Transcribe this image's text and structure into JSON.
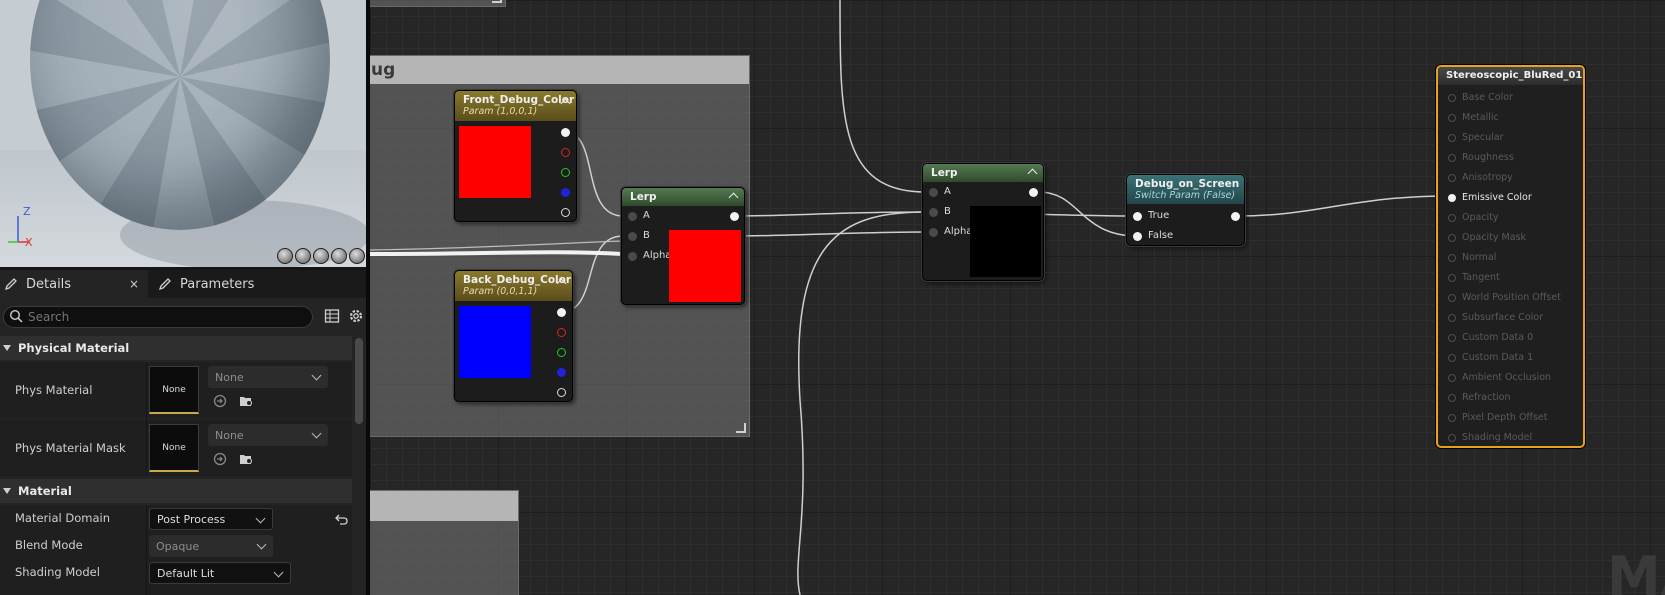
{
  "viewport": {
    "axis": {
      "z": "Z",
      "x": "X"
    }
  },
  "details": {
    "tabs": [
      {
        "label": "Details",
        "icon": "pencil-icon"
      },
      {
        "label": "Parameters",
        "icon": "pencil-icon"
      }
    ],
    "close_symbol": "×",
    "search": {
      "placeholder": "Search",
      "value": ""
    },
    "sections": {
      "physical_material": {
        "title": "Physical Material",
        "rows": [
          {
            "label": "Phys Material",
            "thumb": "None",
            "value": "None"
          },
          {
            "label": "Phys Material Mask",
            "thumb": "None",
            "value": "None"
          }
        ]
      },
      "material": {
        "title": "Material",
        "rows": [
          {
            "label": "Material Domain",
            "value": "Post Process"
          },
          {
            "label": "Blend Mode",
            "value": "Opaque"
          },
          {
            "label": "Shading Model",
            "value": "Default Lit"
          }
        ]
      }
    }
  },
  "graph": {
    "comment_title": "ug",
    "nodes": {
      "front_color": {
        "title": "Front_Debug_Color",
        "subtitle": "Param (1,0,0,1)",
        "swatch": "#ff0000"
      },
      "back_color": {
        "title": "Back_Debug_Color",
        "subtitle": "Param (0,0,1,1)",
        "swatch": "#0000ff"
      },
      "lerp1": {
        "title": "Lerp",
        "pins": [
          "A",
          "B",
          "Alpha"
        ],
        "swatch": "#ff0000"
      },
      "lerp2": {
        "title": "Lerp",
        "pins": [
          "A",
          "B",
          "Alpha"
        ],
        "swatch": "#000000"
      },
      "switch": {
        "title": "Debug_on_Screen",
        "subtitle": "Switch Param (False)",
        "pins": [
          "True",
          "False"
        ]
      },
      "material": {
        "title": "Stereoscopic_BluRed_01",
        "pins": [
          "Base Color",
          "Metallic",
          "Specular",
          "Roughness",
          "Anisotropy",
          "Emissive Color",
          "Opacity",
          "Opacity Mask",
          "Normal",
          "Tangent",
          "World Position Offset",
          "Subsurface Color",
          "Custom Data 0",
          "Custom Data 1",
          "Ambient Occlusion",
          "Refraction",
          "Pixel Depth Offset",
          "Shading Model"
        ],
        "active_pin": "Emissive Color"
      }
    },
    "watermark": "MA"
  },
  "colors": {
    "param_header": "#6e5f22",
    "lerp_header": "#3e5a3c",
    "switch_header": "#2f5a5e",
    "material_border": "#e8a020"
  }
}
